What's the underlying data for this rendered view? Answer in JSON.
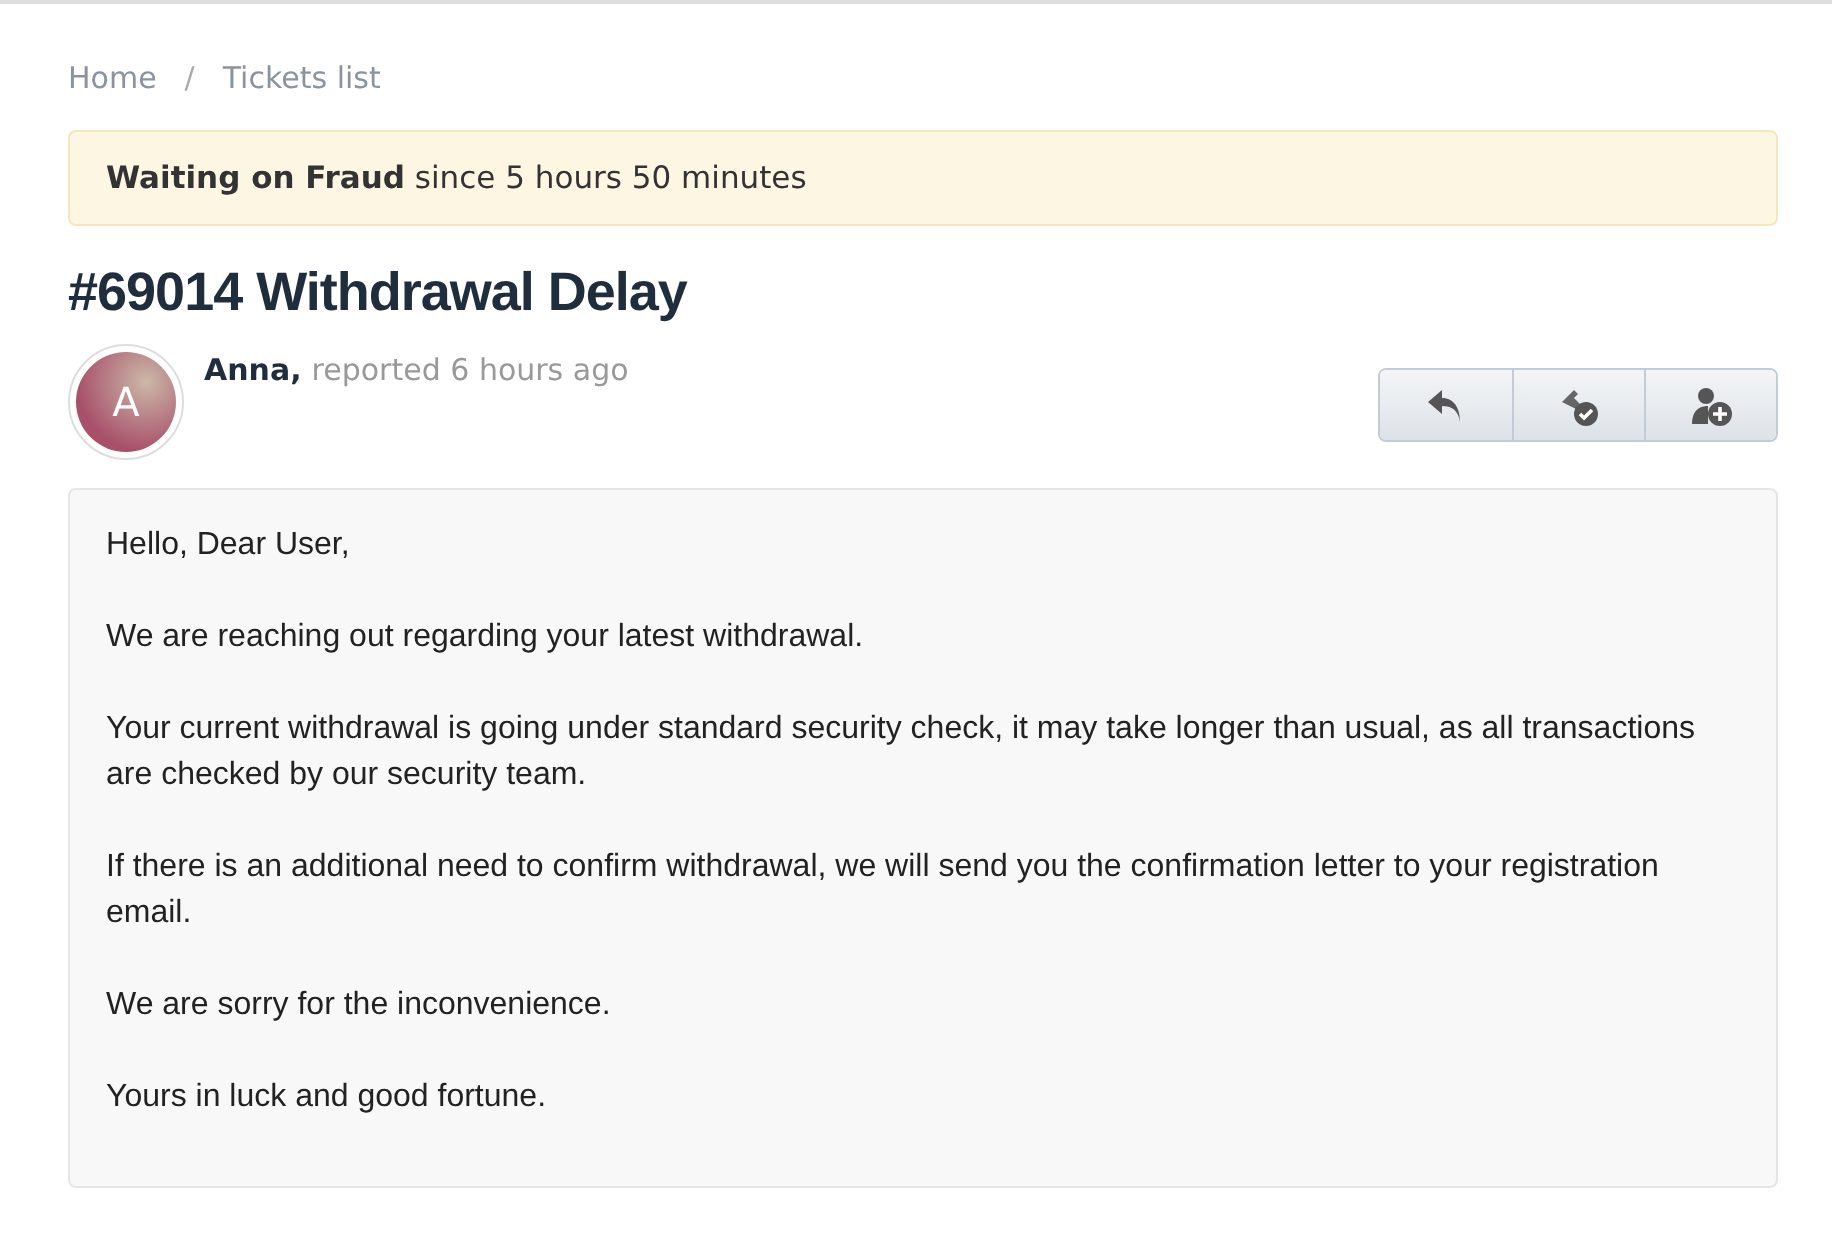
{
  "breadcrumb": [
    "Home",
    "Tickets list"
  ],
  "breadcrumb_separator": "/",
  "status": "**Waiting on Fraud** since 5 hours 50 minutes",
  "title": "#69014 Withdrawal Delay",
  "author": {
    "initial": "A",
    "name": "Anna,",
    "meta": "reported 6 hours ago"
  },
  "actions": [
    {
      "kind": "reply"
    },
    {
      "kind": "resolve"
    },
    {
      "kind": "assign"
    }
  ],
  "message": [
    "Hello, Dear User,",
    "We are reaching out regarding your latest withdrawal.",
    "Your current withdrawal is going under standard security check, it may take longer than usual, as all transactions are checked by our security team.",
    "If there is an additional need to confirm withdrawal, we will send you the confirmation letter to your registration email.",
    "We are sorry for the inconvenience.",
    "Yours in luck and good fortune."
  ]
}
